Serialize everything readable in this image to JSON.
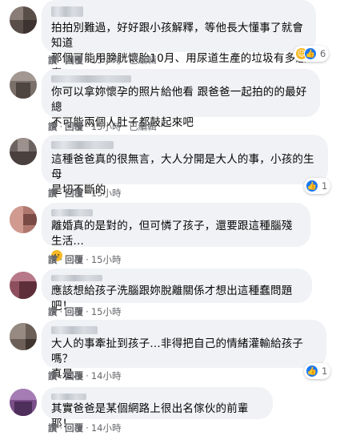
{
  "comments": [
    {
      "text": "拍拍別難過，好好跟小孩解釋，等他長大懂事了就會知道\n那個可能用膀胱懷胎10月、用尿道生產的垃圾有多愚蠢",
      "actions": [
        "讚",
        "回覆",
        "15小時",
        "已編輯"
      ],
      "reactions": {
        "icons": [
          "haha",
          "like"
        ],
        "count": "6"
      }
    },
    {
      "text": "你可以拿妳懷孕的照片給他看 跟爸爸一起拍的的最好 總\n不可能兩個人肚子都鼓起來吧",
      "actions": [
        "讚",
        "回覆",
        "15小時",
        "已編輯"
      ]
    },
    {
      "text": "這種爸爸真的很無言，大人分開是大人的事，小孩的生母\n是切不斷的",
      "actions": [
        "讚",
        "回覆",
        "15小時"
      ],
      "reactions": {
        "icons": [
          "like"
        ],
        "count": "1"
      }
    },
    {
      "text": "離婚真的是對的，但可憐了孩子，還要跟這種腦殘生活…",
      "actions": [
        "讚",
        "回覆",
        "15小時"
      ]
    },
    {
      "text": "應該想給孩子洗腦跟妳脫離關係才想出這種蠢問題吧！",
      "actions": [
        "讚",
        "回覆",
        "15小時"
      ]
    },
    {
      "text": "大人的事牽扯到孩子…非得把自己的情緒灌輸給孩子嗎？\n真是…",
      "actions": [
        "讚",
        "回覆",
        "14小時"
      ],
      "reactions": {
        "icons": [
          "like"
        ],
        "count": "1"
      }
    },
    {
      "text": "其實爸爸是某個網路上很出名傢伙的前輩耶！",
      "actions": [
        "讚",
        "回覆",
        "14小時"
      ]
    }
  ]
}
